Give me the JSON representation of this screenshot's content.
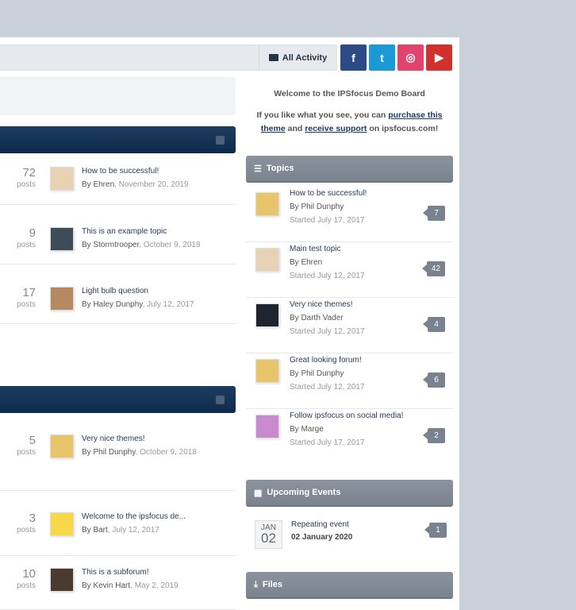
{
  "header": {
    "all_activity": "All Activity",
    "social": [
      {
        "name": "facebook",
        "glyph": "f",
        "color": "#2b4a86"
      },
      {
        "name": "twitter",
        "glyph": "t",
        "color": "#1b9ad6"
      },
      {
        "name": "instagram",
        "glyph": "◎",
        "color": "#e0446e"
      },
      {
        "name": "youtube",
        "glyph": "▶",
        "color": "#d0312d"
      }
    ]
  },
  "categories": [
    {
      "rows": [
        {
          "count": "72",
          "posts": "posts",
          "title": "How to be successful!",
          "by": "By Ehren",
          "date": "November 20, 2019",
          "avatar": "#e8d2b4"
        },
        {
          "count": "9",
          "posts": "posts",
          "title": "This is an example topic",
          "by": "By Stormtrooper",
          "date": "October 9, 2018",
          "avatar": "#3e4c5a"
        },
        {
          "count": "17",
          "posts": "posts",
          "title": "Light bulb question",
          "by": "By Haley Dunphy",
          "date": "July 12, 2017",
          "avatar": "#b58a63"
        }
      ]
    },
    {
      "rows": [
        {
          "count": "5",
          "posts": "posts",
          "title": "Very nice themes!",
          "by": "By Phil Dunphy",
          "date": "October 9, 2018",
          "avatar": "#e8c46a"
        },
        {
          "count": "3",
          "posts": "posts",
          "title": "Welcome to the ipsfocus de...",
          "by": "By Bart",
          "date": "July 12, 2017",
          "avatar": "#f6d94a"
        },
        {
          "count": "10",
          "posts": "posts",
          "title": "This is a subforum!",
          "by": "By Kevin Hart",
          "date": "May 2, 2019",
          "avatar": "#4b3a30"
        }
      ]
    }
  ],
  "sidebar": {
    "welcome_title": "Welcome to the IPSfocus Demo Board",
    "welcome_pre": "If you like what you see, you can ",
    "purchase_link": "purchase this theme",
    "welcome_mid": " and ",
    "support_link": "receive support",
    "welcome_post": " on ipsfocus.com!",
    "topics_title": "Topics",
    "topics": [
      {
        "title": "How to be successful!",
        "by": "By Phil Dunphy",
        "started": "Started July 17, 2017",
        "count": "7",
        "avatar": "#e8c46a"
      },
      {
        "title": "Main test topic",
        "by": "By Ehren",
        "started": "Started July 12, 2017",
        "count": "42",
        "avatar": "#e8d2b4"
      },
      {
        "title": "Very nice themes!",
        "by": "By Darth Vader",
        "started": "Started July 12, 2017",
        "count": "4",
        "avatar": "#1c2530"
      },
      {
        "title": "Great looking forum!",
        "by": "By Phil Dunphy",
        "started": "Started July 12, 2017",
        "count": "6",
        "avatar": "#e8c46a"
      },
      {
        "title": "Follow ipsfocus on social media!",
        "by": "By Marge",
        "started": "Started July 17, 2017",
        "count": "2",
        "avatar": "#c98ad0"
      }
    ],
    "events_title": "Upcoming Events",
    "event": {
      "month": "JAN",
      "day": "02",
      "title": "Repeating event",
      "date": "02 January 2020",
      "count": "1"
    },
    "files_title": "Files"
  }
}
